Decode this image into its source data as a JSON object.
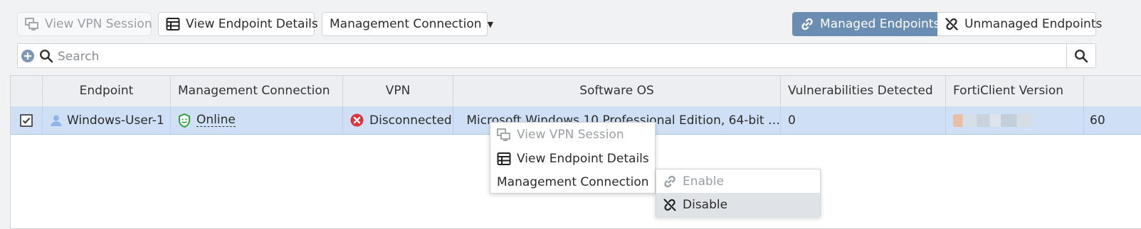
{
  "toolbar": {
    "view_vpn_session": "View VPN Session",
    "view_endpoint_details": "View Endpoint Details",
    "management_connection": "Management Connection",
    "managed_endpoints": "Managed Endpoints",
    "unmanaged_endpoints": "Unmanaged Endpoints"
  },
  "search": {
    "placeholder": "Search",
    "value": ""
  },
  "table": {
    "columns": [
      "Endpoint",
      "Management Connection",
      "VPN",
      "Software OS",
      "Vulnerabilities Detected",
      "FortiClient Version"
    ],
    "rows": [
      {
        "selected": true,
        "endpoint": "Windows-User-1",
        "management_connection": "Online",
        "vpn": "Disconnected",
        "software_os": "Microsoft Windows 10 Professional Edition, 64-bit …",
        "vulnerabilities": "0",
        "forticlient_version": "",
        "extra": "60"
      }
    ]
  },
  "context_menu": {
    "items": [
      "View VPN Session",
      "View Endpoint Details",
      "Management Connection"
    ],
    "submenu": [
      "Enable",
      "Disable"
    ]
  },
  "colors": {
    "accent": "#6b8db1",
    "selected_row": "#cfe0f6",
    "online": "#2e9e3e",
    "disconnected": "#d9363e",
    "windows": "#1f6fd0"
  }
}
